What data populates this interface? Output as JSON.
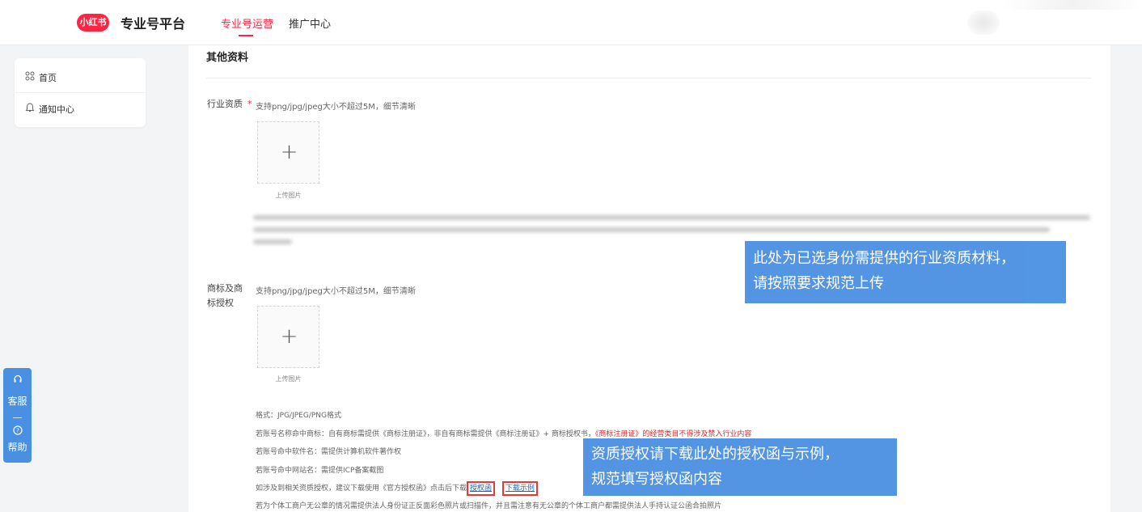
{
  "header": {
    "logo_text": "小红书",
    "platform_title": "专业号平台",
    "tabs": [
      {
        "label": "专业号运营",
        "active": true
      },
      {
        "label": "推广中心",
        "active": false
      }
    ]
  },
  "sidebar": {
    "items": [
      {
        "label": "首页",
        "icon": "grid-icon"
      },
      {
        "label": "通知中心",
        "icon": "bell-icon"
      }
    ]
  },
  "float_bar": {
    "service_label": "客服",
    "help_label": "帮助"
  },
  "section": {
    "title": "其他资料"
  },
  "industry_qualification": {
    "label": "行业资质",
    "required_mark": "*",
    "hint": "支持png/jpg/jpeg大小不超过5M，细节清晰",
    "upload_label": "上传图片"
  },
  "trademark": {
    "label": "商标及商标授权",
    "hint": "支持png/jpg/jpeg大小不超过5M，细节清晰",
    "upload_label": "上传图片"
  },
  "notes": {
    "format": "格式：JPG/JPEG/PNG格式",
    "trademark_prefix": "若账号名称命中商标：自有商标需提供《商标注册证》，非自有商标需提供《商标注册证》+ 商标授权书，",
    "trademark_red": "《商标注册证》的经营类目不得涉及禁入行业内容",
    "software": "若账号命中软件名：需提供计算机软件著作权",
    "website": "若账号命中网站名：需提供ICP备案截图",
    "auth_prefix": "如涉及到相关资质授权，建议下载使用《官方授权函》点击后下载",
    "auth_link": "授权函",
    "example_link": "下载示例",
    "individual": "若为个体工商户无公章的情况需提供法人身份证正反面彩色照片或扫描件，并且需注意有无公章的个体工商户都需提供法人手持认证公函合拍照片"
  },
  "annotations": {
    "first": [
      "此处为已选身份需提供的行业资质材料，",
      "请按照要求规范上传"
    ],
    "second": [
      "资质授权请下载此处的授权函与示例，",
      "规范填写授权函内容"
    ]
  },
  "colors": {
    "brand": "#ff2442",
    "annotation": "#4a90e2",
    "link": "#1565c0",
    "highlight_border": "#e53935"
  }
}
